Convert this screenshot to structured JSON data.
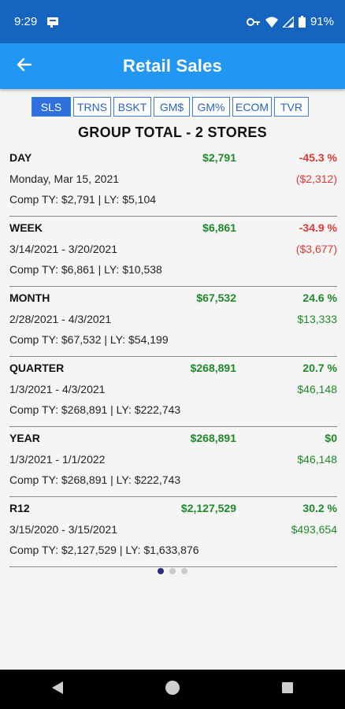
{
  "status": {
    "time": "9:29",
    "battery": "91%"
  },
  "header": {
    "title": "Retail Sales"
  },
  "tabs": [
    {
      "label": "SLS",
      "active": true
    },
    {
      "label": "TRNS",
      "active": false
    },
    {
      "label": "BSKT",
      "active": false
    },
    {
      "label": "GM$",
      "active": false
    },
    {
      "label": "GM%",
      "active": false
    },
    {
      "label": "ECOM",
      "active": false
    },
    {
      "label": "TVR",
      "active": false
    }
  ],
  "group_title": "GROUP TOTAL - 2 STORES",
  "rows": [
    {
      "period": "DAY",
      "amount": "$2,791",
      "pct": "-45.3 %",
      "dates": "Monday, Mar 15, 2021",
      "diff": "($2,312)",
      "comp": "Comp TY: $2,791 | LY: $5,104",
      "sign": "neg"
    },
    {
      "period": "WEEK",
      "amount": "$6,861",
      "pct": "-34.9 %",
      "dates": "3/14/2021 - 3/20/2021",
      "diff": "($3,677)",
      "comp": "Comp TY: $6,861 | LY: $10,538",
      "sign": "neg"
    },
    {
      "period": "MONTH",
      "amount": "$67,532",
      "pct": "24.6 %",
      "dates": "2/28/2021 - 4/3/2021",
      "diff": "$13,333",
      "comp": "Comp TY: $67,532 | LY: $54,199",
      "sign": "pos"
    },
    {
      "period": "QUARTER",
      "amount": "$268,891",
      "pct": "20.7 %",
      "dates": "1/3/2021 - 4/3/2021",
      "diff": "$46,148",
      "comp": "Comp TY: $268,891 | LY: $222,743",
      "sign": "pos"
    },
    {
      "period": "YEAR",
      "amount": "$268,891",
      "pct": "$0",
      "dates": "1/3/2021 - 1/1/2022",
      "diff": "$46,148",
      "comp": "Comp TY: $268,891 | LY: $222,743",
      "sign": "pos"
    },
    {
      "period": "R12",
      "amount": "$2,127,529",
      "pct": "30.2 %",
      "dates": "3/15/2020 - 3/15/2021",
      "diff": "$493,654",
      "comp": "Comp TY: $2,127,529 | LY: $1,633,876",
      "sign": "pos"
    }
  ],
  "pager": {
    "count": 3,
    "active": 0
  },
  "icons": {
    "status": [
      "notification-icon",
      "vpn-key-icon",
      "wifi-icon",
      "signal-icon",
      "battery-icon"
    ],
    "back": "arrow-left-icon",
    "nav": [
      "back-triangle-icon",
      "home-circle-icon",
      "recents-square-icon"
    ]
  },
  "colors": {
    "statusbar": "#1565c0",
    "appbar": "#2196f3",
    "tab_active": "#2f6fde",
    "positive": "#1e8a2a",
    "negative": "#e53935"
  }
}
